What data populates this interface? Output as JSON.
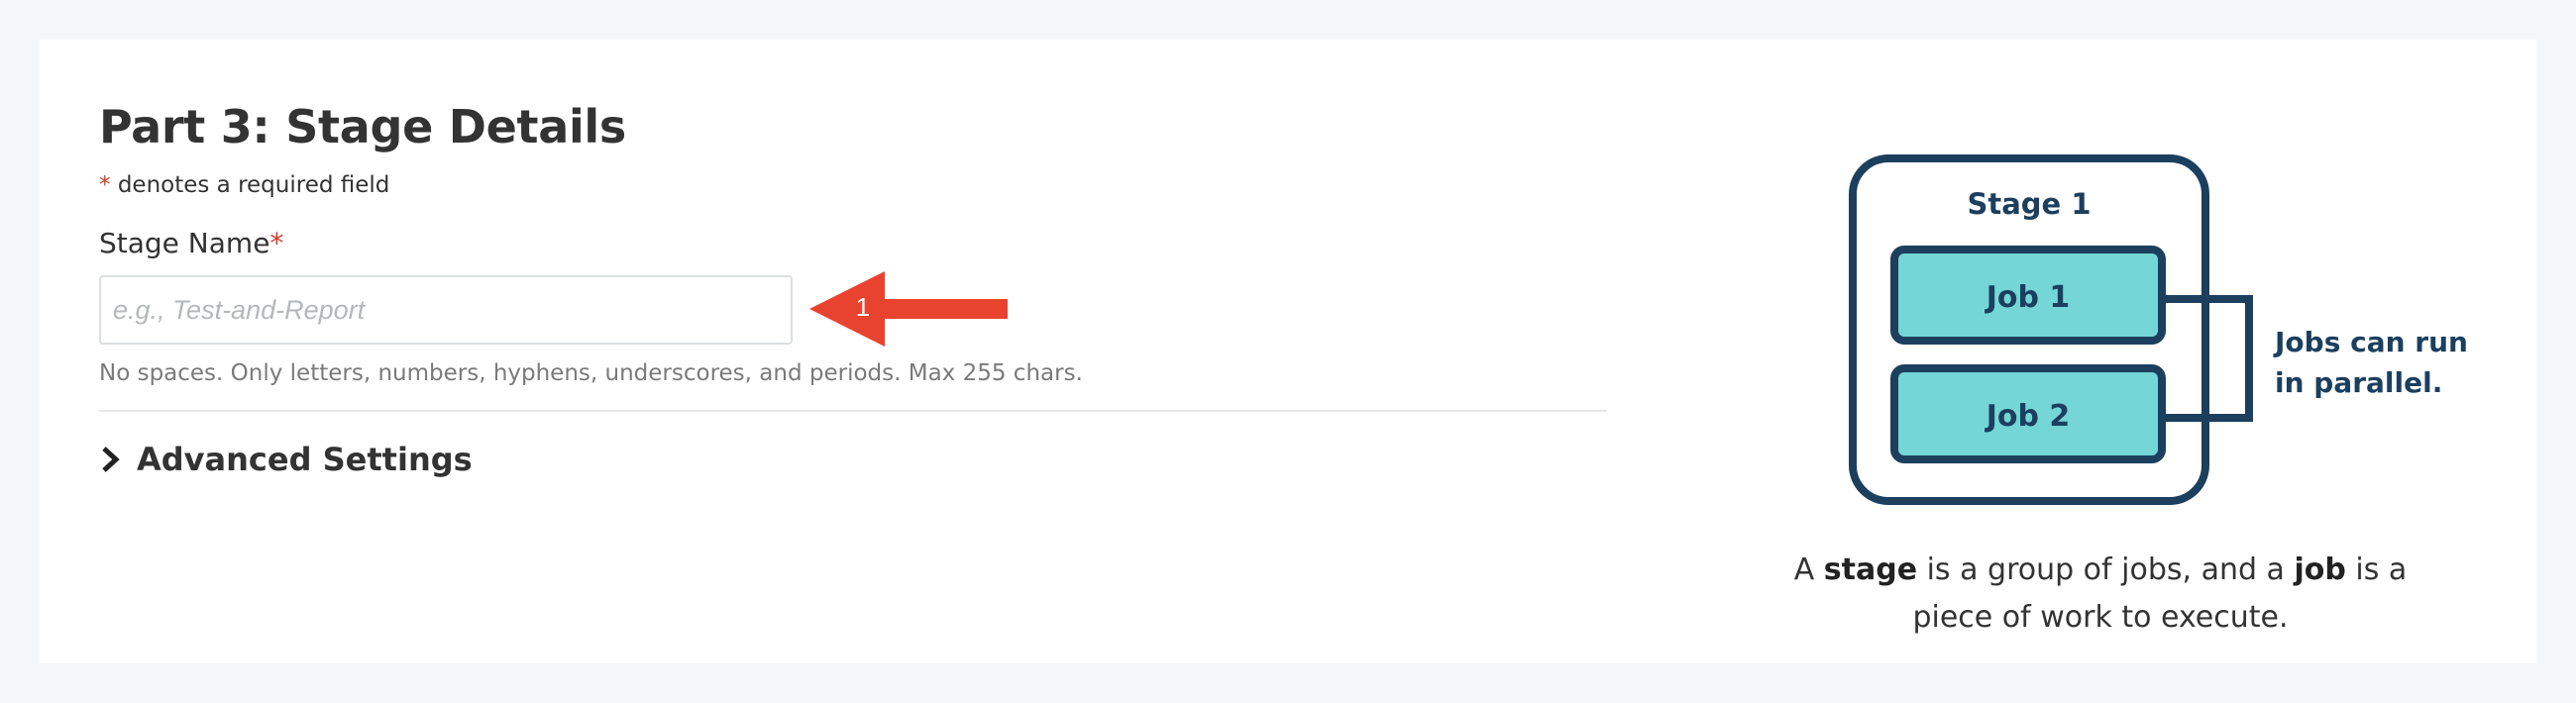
{
  "form": {
    "title": "Part 3: Stage Details",
    "required_star": "*",
    "required_note": "denotes a required field",
    "stage_name": {
      "label": "Stage Name",
      "required_star": "*",
      "value": "",
      "placeholder": "e.g., Test-and-Report",
      "hint": "No spaces. Only letters, numbers, hyphens, underscores, and periods. Max 255 chars."
    },
    "advanced_settings": {
      "label": "Advanced Settings",
      "icon": "chevron-right-icon"
    }
  },
  "callout": {
    "number": "1",
    "color": "#e8432f"
  },
  "diagram": {
    "stage_label": "Stage 1",
    "jobs": [
      "Job 1",
      "Job 2"
    ],
    "note_line1": "Jobs can run",
    "note_line2": "in parallel.",
    "colors": {
      "outline": "#1c3f5e",
      "job_fill": "#74d6d6"
    }
  },
  "caption": {
    "part1": "A ",
    "bold1": "stage",
    "part2": " is a group of jobs, and a ",
    "bold2": "job",
    "part3": " is a",
    "line2": "piece of work to execute."
  }
}
